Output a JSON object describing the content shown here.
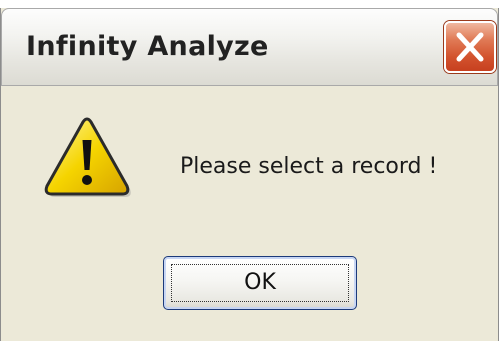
{
  "window": {
    "title": "Infinity Analyze",
    "close_icon": "close-icon"
  },
  "dialog": {
    "icon": "warning-icon",
    "message": "Please select a record !",
    "ok_label": "OK"
  },
  "colors": {
    "dialog_bg": "#ece9d8",
    "close_button": "#d3532e",
    "warning_yellow": "#f5d400",
    "focus_border": "#1c3a7a"
  }
}
